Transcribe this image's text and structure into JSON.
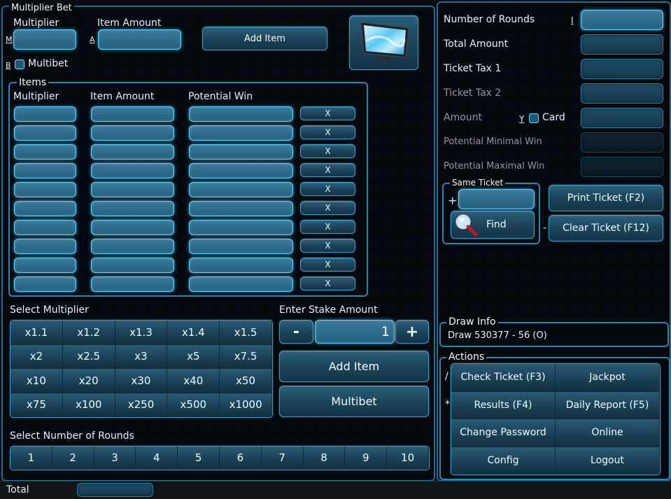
{
  "multiplier_bet": {
    "legend": "Multiplier Bet",
    "multiplier_label": "Multiplier",
    "multiplier_key": "M",
    "item_amount_label": "Item Amount",
    "item_amount_key": "A",
    "add_item_label": "Add Item",
    "multibet_key": "B",
    "multibet_label": "Multibet",
    "tv_icon": "tv-icon"
  },
  "items": {
    "legend": "Items",
    "headers": [
      "Multiplier",
      "Item Amount",
      "Potential Win"
    ],
    "remove_label": "X",
    "row_count": 10
  },
  "select_multiplier": {
    "label": "Select Multiplier",
    "values": [
      "x1.1",
      "x1.2",
      "x1.3",
      "x1.4",
      "x1.5",
      "x2",
      "x2.5",
      "x3",
      "x5",
      "x7.5",
      "x10",
      "x20",
      "x30",
      "x40",
      "x50",
      "x75",
      "x100",
      "x250",
      "x500",
      "x1000"
    ]
  },
  "stake": {
    "label": "Enter Stake Amount",
    "minus": "-",
    "plus": "+",
    "value": "1",
    "add_item_label": "Add Item",
    "multibet_label": "Multibet"
  },
  "rounds": {
    "label": "Select Number of Rounds",
    "values": [
      "1",
      "2",
      "3",
      "4",
      "5",
      "6",
      "7",
      "8",
      "9",
      "10"
    ]
  },
  "summary": {
    "number_of_rounds": "Number of Rounds",
    "rounds_key": "I",
    "total_amount": "Total Amount",
    "ticket_tax_1": "Ticket Tax 1",
    "ticket_tax_2": "Ticket Tax 2",
    "amount": "Amount",
    "card_key": "Y",
    "card_label": "Card",
    "potential_minimal_win": "Potential Minimal Win",
    "potential_maximal_win": "Potential Maximal Win"
  },
  "same_ticket": {
    "legend": "Same Ticket",
    "plus_key": "+",
    "find_label": "Find",
    "minus_key": "-",
    "print_label": "Print Ticket (F2)",
    "clear_label": "Clear Ticket (F12)"
  },
  "draw_info": {
    "legend": "Draw Info",
    "value": "Draw 530377 - 56 (O)"
  },
  "actions": {
    "legend": "Actions",
    "key_slash": "/",
    "key_star": "*",
    "check_ticket": "Check Ticket (F3)",
    "jackpot": "Jackpot",
    "results": "Results (F4)",
    "daily_report": "Daily Report (F5)",
    "change_password": "Change Password",
    "online": "Online",
    "config": "Config",
    "logout": "Logout"
  },
  "status": {
    "total_label": "Total"
  }
}
